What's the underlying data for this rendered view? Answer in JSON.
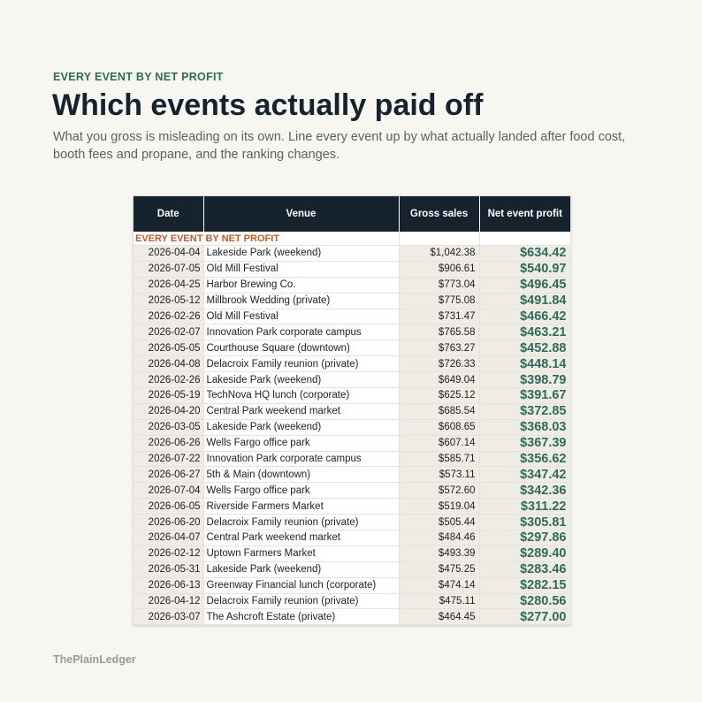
{
  "header": {
    "eyebrow": "EVERY EVENT BY NET PROFIT",
    "title": "Which events actually paid off",
    "subtitle": "What you gross is misleading on its own. Line every event up by what actually landed after food cost, booth fees and propane, and the ranking changes."
  },
  "sheet": {
    "title": "EVERY EVENT BY NET PROFIT",
    "columns": [
      "Date",
      "Venue",
      "Gross sales",
      "Net event profit"
    ],
    "rows": [
      [
        "2026-04-04",
        "Lakeside Park (weekend)",
        "$1,042.38",
        "$634.42"
      ],
      [
        "2026-07-05",
        "Old Mill Festival",
        "$906.61",
        "$540.97"
      ],
      [
        "2026-04-25",
        "Harbor Brewing Co.",
        "$773.04",
        "$496.45"
      ],
      [
        "2026-05-12",
        "Millbrook Wedding (private)",
        "$775.08",
        "$491.84"
      ],
      [
        "2026-02-26",
        "Old Mill Festival",
        "$731.47",
        "$466.42"
      ],
      [
        "2026-02-07",
        "Innovation Park corporate campus",
        "$765.58",
        "$463.21"
      ],
      [
        "2026-05-05",
        "Courthouse Square (downtown)",
        "$763.27",
        "$452.88"
      ],
      [
        "2026-04-08",
        "Delacroix Family reunion (private)",
        "$726.33",
        "$448.14"
      ],
      [
        "2026-02-26",
        "Lakeside Park (weekend)",
        "$649.04",
        "$398.79"
      ],
      [
        "2026-05-19",
        "TechNova HQ lunch (corporate)",
        "$625.12",
        "$391.67"
      ],
      [
        "2026-04-20",
        "Central Park weekend market",
        "$685.54",
        "$372.85"
      ],
      [
        "2026-03-05",
        "Lakeside Park (weekend)",
        "$608.65",
        "$368.03"
      ],
      [
        "2026-06-26",
        "Wells Fargo office park",
        "$607.14",
        "$367.39"
      ],
      [
        "2026-07-22",
        "Innovation Park corporate campus",
        "$585.71",
        "$356.62"
      ],
      [
        "2026-06-27",
        "5th & Main (downtown)",
        "$573.11",
        "$347.42"
      ],
      [
        "2026-07-04",
        "Wells Fargo office park",
        "$572.60",
        "$342.36"
      ],
      [
        "2026-06-05",
        "Riverside Farmers Market",
        "$519.04",
        "$311.22"
      ],
      [
        "2026-06-20",
        "Delacroix Family reunion (private)",
        "$505.44",
        "$305.81"
      ],
      [
        "2026-04-07",
        "Central Park weekend market",
        "$484.46",
        "$297.86"
      ],
      [
        "2026-02-12",
        "Uptown Farmers Market",
        "$493.39",
        "$289.40"
      ],
      [
        "2026-05-31",
        "Lakeside Park (weekend)",
        "$475.25",
        "$283.46"
      ],
      [
        "2026-06-13",
        "Greenway Financial lunch (corporate)",
        "$474.14",
        "$282.15"
      ],
      [
        "2026-04-12",
        "Delacroix Family reunion (private)",
        "$475.11",
        "$280.56"
      ],
      [
        "2026-03-07",
        "The Ashcroft Estate (private)",
        "$464.45",
        "$277.00"
      ]
    ]
  },
  "footer": {
    "brand": "ThePlainLedger"
  },
  "colors": {
    "accent_green": "#2f6b5a",
    "accent_orange": "#c05a2b",
    "header_navy": "#17222f",
    "background": "#f8f6f1"
  }
}
